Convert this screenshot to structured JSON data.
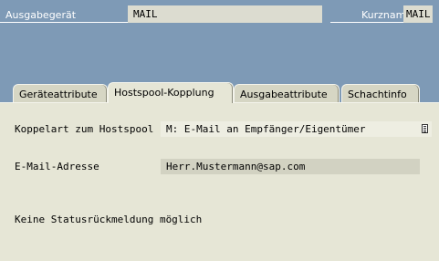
{
  "header": {
    "output_device_label": "Ausgabegerät",
    "output_device_value": "MAIL",
    "short_name_label": "Kurzname",
    "short_name_value": "MAIL"
  },
  "tabs": [
    {
      "label": "Geräteattribute",
      "active": false
    },
    {
      "label": "Hostspool-Kopplung",
      "active": true
    },
    {
      "label": "Ausgabeattribute",
      "active": false
    },
    {
      "label": "Schachtinfo",
      "active": false
    }
  ],
  "panel": {
    "coupling_type_label": "Koppelart zum Hostspool",
    "coupling_type_value": "M: E-Mail an Empfänger/Eigentümer",
    "email_label": "E-Mail-Adresse",
    "email_value": "Herr.Mustermann@sap.com",
    "status_text": "Keine Statusrückmeldung möglich"
  }
}
